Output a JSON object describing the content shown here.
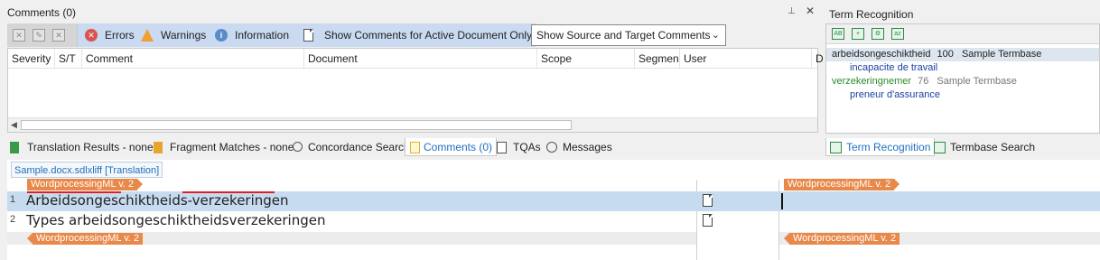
{
  "comments_panel": {
    "title": "Comments (0)",
    "filters": {
      "errors": "Errors",
      "warnings": "Warnings",
      "information": "Information",
      "active_doc_only": "Show Comments for Active Document Only"
    },
    "comment_scope_select": "Show Source and Target Comments",
    "columns": [
      "Severity",
      "S/T",
      "Comment",
      "Document",
      "Scope",
      "Segmen",
      "User",
      "D"
    ]
  },
  "bottom_tabs": [
    {
      "label": "Translation Results - none",
      "icon": "translation-results-icon"
    },
    {
      "label": "Fragment Matches - none",
      "icon": "fragment-matches-icon"
    },
    {
      "label": "Concordance Search",
      "icon": "concordance-icon"
    },
    {
      "label": "Comments (0)",
      "icon": "comments-icon",
      "active": true
    },
    {
      "label": "TQAs",
      "icon": "tqa-icon"
    },
    {
      "label": "Messages",
      "icon": "messages-icon"
    }
  ],
  "term_panel": {
    "title": "Term Recognition",
    "results": [
      {
        "term": "arbeidsongeschiktheid",
        "score": "100",
        "termbase": "Sample Termbase",
        "translation": "incapacite de travail"
      },
      {
        "term": "verzekeringnemer",
        "score": "76",
        "termbase": "Sample Termbase",
        "translation": "preneur d'assurance"
      }
    ],
    "tabs": [
      "Term Recognition",
      "Termbase Search"
    ]
  },
  "editor": {
    "document_tab": "Sample.docx.sdlxliff [Translation]",
    "tag_label": "WordprocessingML v. 2",
    "segments": [
      {
        "num": "1",
        "source": "Arbeidsongeschiktheids-verzekeringen",
        "target": ""
      },
      {
        "num": "2",
        "source": "Types arbeidsongeschiktheidsverzekeringen",
        "target": ""
      }
    ]
  },
  "colors": {
    "filter_bar": "#c9daf1",
    "tag": "#e8894a",
    "selected_row": "#c6dbef",
    "link_blue": "#1f6fbf"
  }
}
